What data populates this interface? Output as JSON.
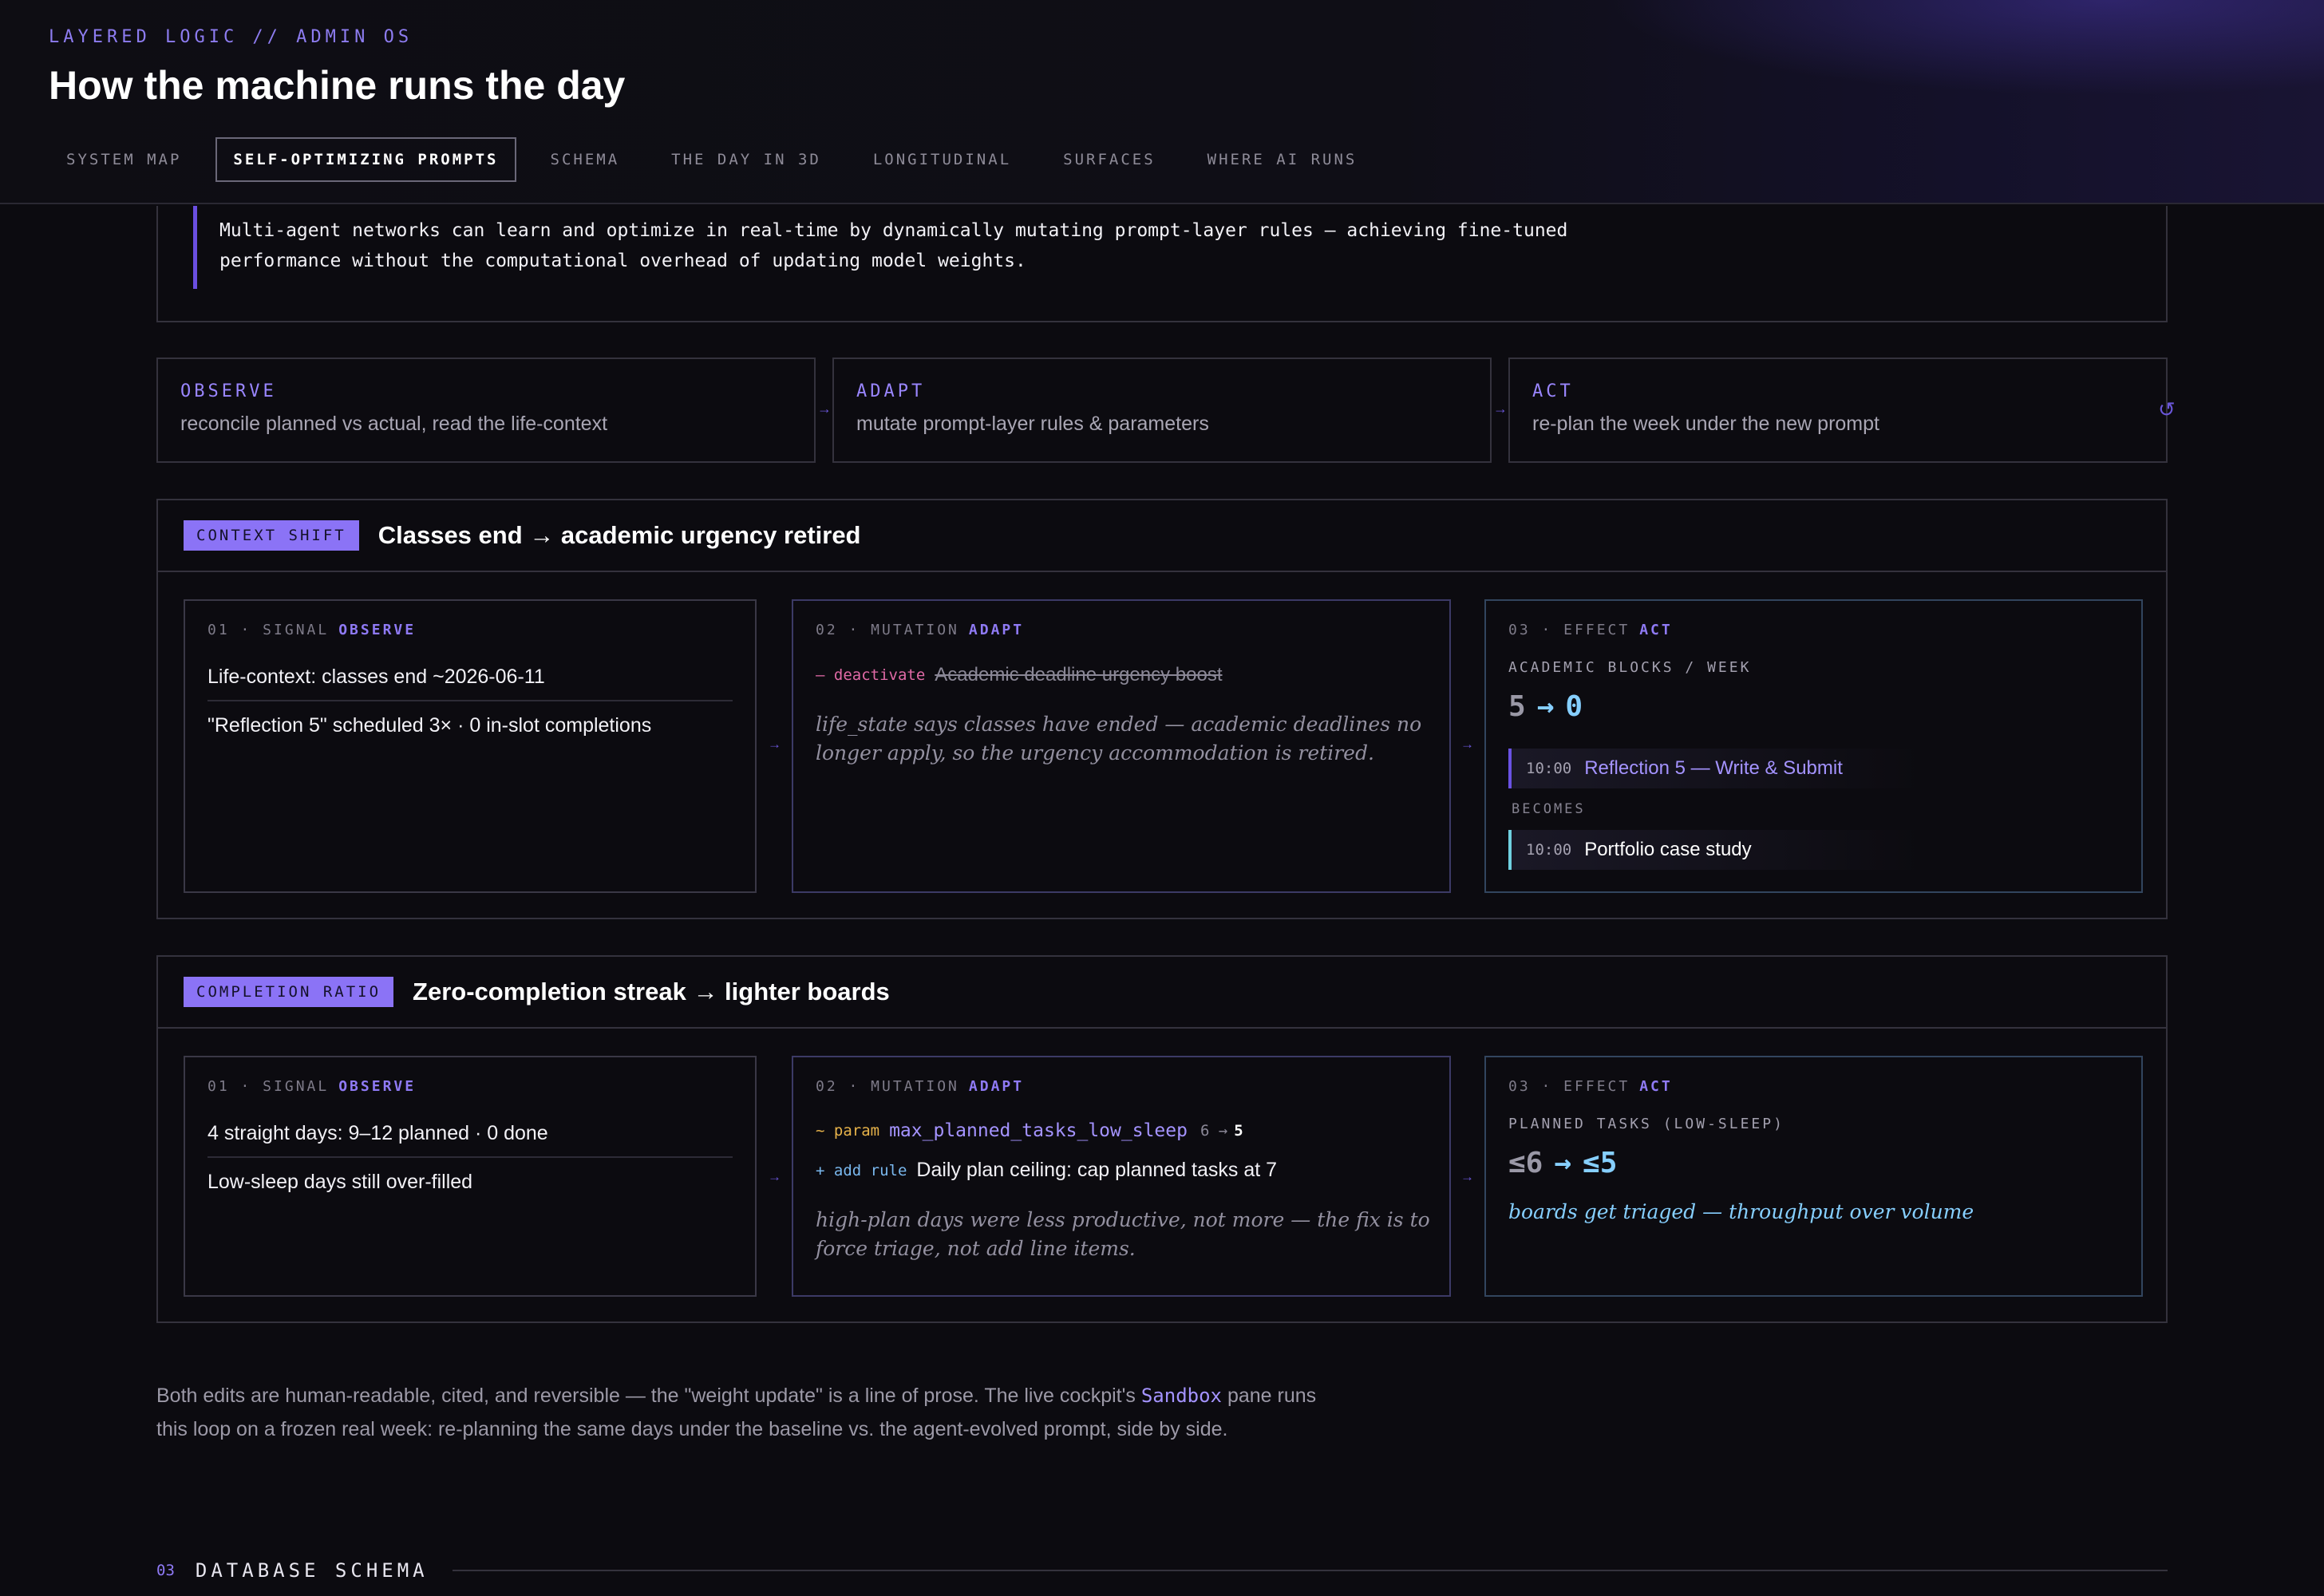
{
  "header": {
    "eyebrow": "LAYERED LOGIC // ADMIN OS",
    "title": "How the machine runs the day",
    "tabs": [
      {
        "label": "SYSTEM MAP",
        "active": false
      },
      {
        "label": "SELF-OPTIMIZING PROMPTS",
        "active": true
      },
      {
        "label": "SCHEMA",
        "active": false
      },
      {
        "label": "THE DAY IN 3D",
        "active": false
      },
      {
        "label": "LONGITUDINAL",
        "active": false
      },
      {
        "label": "SURFACES",
        "active": false
      },
      {
        "label": "WHERE AI RUNS",
        "active": false
      }
    ]
  },
  "intro": {
    "line1": "Multi-agent networks can learn and optimize in real-time by dynamically mutating prompt-layer rules — achieving fine-tuned",
    "line2": "performance without the computational overhead of updating model weights."
  },
  "loop": [
    {
      "key": "OBSERVE",
      "desc": "reconcile planned vs actual, read the life-context"
    },
    {
      "key": "ADAPT",
      "desc": "mutate prompt-layer rules & parameters"
    },
    {
      "key": "ACT",
      "desc": "re-plan the week under the new prompt"
    }
  ],
  "loop_arrow": "→",
  "cycle_icon": "↺",
  "stage_labels": {
    "signal": "01 · SIGNAL",
    "mutation": "02 · MUTATION",
    "effect": "03 · EFFECT",
    "observe": "OBSERVE",
    "adapt": "ADAPT",
    "act": "ACT"
  },
  "section1": {
    "badge": "CONTEXT SHIFT",
    "title": "Classes end → academic urgency retired",
    "signal_1": "Life-context: classes end ~2026-06-11",
    "signal_2": "\"Reflection 5\" scheduled 3× · 0 in-slot completions",
    "mutation_op": "– deactivate",
    "mutation_rule": "Academic deadline urgency boost",
    "mutation_note": "life_state says classes have ended — academic deadlines no longer apply, so the urgency accommodation is retired.",
    "effect_label": "ACADEMIC BLOCKS / WEEK",
    "effect_from": "5",
    "effect_arrow": "→",
    "effect_to": "0",
    "slot_before_time": "10:00",
    "slot_before_name": "Reflection 5 — Write & Submit",
    "becomes": "BECOMES",
    "slot_after_time": "10:00",
    "slot_after_name": "Portfolio case study"
  },
  "section2": {
    "badge": "COMPLETION RATIO",
    "title": "Zero-completion streak → lighter boards",
    "signal_1": "4 straight days: 9–12 planned · 0 done",
    "signal_2": "Low-sleep days still over-filled",
    "param_op": "~ param",
    "param_name": "max_planned_tasks_low_sleep",
    "param_from": "6 →",
    "param_to": "5",
    "add_op": "+ add rule",
    "add_rule": "Daily plan ceiling: cap planned tasks at 7",
    "mutation_note": "high-plan days were less productive, not more — the fix is to force triage, not add line items.",
    "effect_label": "PLANNED TASKS (LOW-SLEEP)",
    "effect_from": "≤6",
    "effect_arrow": "→",
    "effect_to": "≤5",
    "effect_note": "boards get triaged — throughput over volume"
  },
  "footer": {
    "part1": "Both edits are human-readable, cited, and reversible — the \"weight update\" is a line of prose. The live cockpit's ",
    "code": "Sandbox",
    "part2": " pane runs",
    "line2": "this loop on a frozen real week: re-planning the same days under the baseline vs. the agent-evolved prompt, side by side."
  },
  "next_section": {
    "num": "03",
    "title": "DATABASE SCHEMA"
  }
}
